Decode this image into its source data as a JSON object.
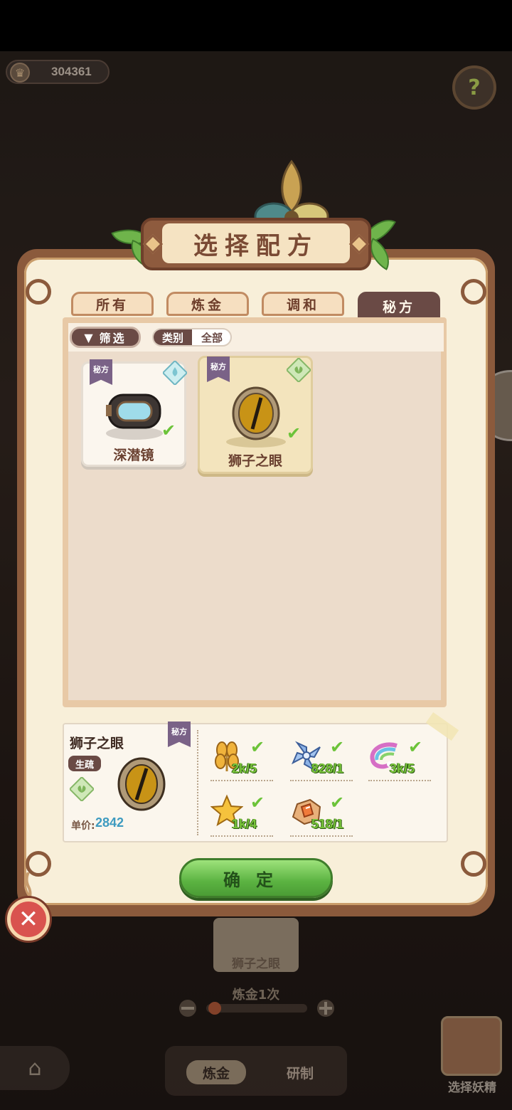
{
  "currency": {
    "value": "304361"
  },
  "title": "选择配方",
  "tabs": [
    {
      "label": "所有",
      "active": false
    },
    {
      "label": "炼金",
      "active": false
    },
    {
      "label": "调和",
      "active": false
    },
    {
      "label": "秘方",
      "active": true
    }
  ],
  "filter": {
    "button_label": "筛选",
    "category_label": "类别",
    "category_value": "全部"
  },
  "recipes": [
    {
      "name": "深潜镜",
      "badge": "秘方",
      "element": "water-drop-icon",
      "unlocked": true
    },
    {
      "name": "狮子之眼",
      "badge": "秘方",
      "element": "leaf-icon",
      "unlocked": true,
      "selected": true
    }
  ],
  "detail": {
    "name": "狮子之眼",
    "badge": "秘方",
    "rarity": "生疏",
    "price_label": "单价:",
    "price": "2842",
    "ingredients": [
      {
        "icon": "wheat-icon",
        "count": "2k/5",
        "ok": true
      },
      {
        "icon": "pinwheel-flower-icon",
        "count": "828/1",
        "ok": true
      },
      {
        "icon": "rainbow-feather-icon",
        "count": "3k/5",
        "ok": true
      },
      {
        "icon": "star-icon",
        "count": "1k/4",
        "ok": true
      },
      {
        "icon": "ore-icon",
        "count": "518/1",
        "ok": true
      }
    ]
  },
  "confirm_label": "确定",
  "background": {
    "card_name": "狮子之眼",
    "count_text": "炼金1次",
    "tab_a": "炼金",
    "tab_b": "研制",
    "fairy_label": "选择妖精"
  },
  "colors": {
    "panel_brown": "#8b5a3c",
    "accent_green": "#5bb341",
    "tab_active": "#6a4a45",
    "price_blue": "#3e9bc0"
  }
}
